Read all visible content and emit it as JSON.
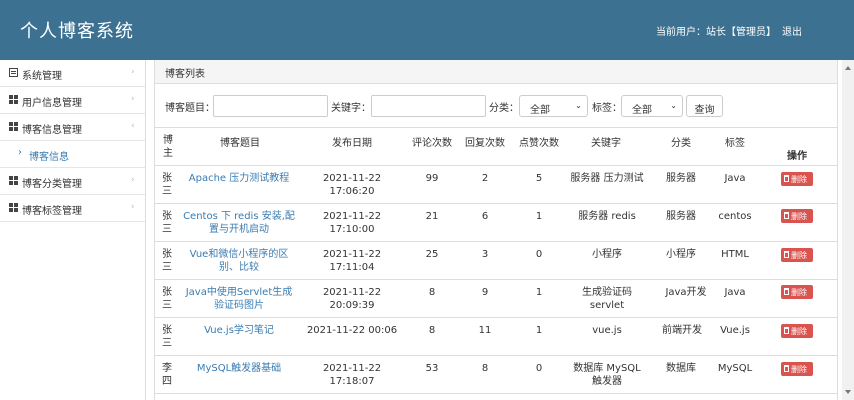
{
  "header": {
    "title": "个人博客系统",
    "user_info": "当前用户：站长【管理员】",
    "logout": "退出"
  },
  "sidebar": {
    "items": [
      {
        "label": "系统管理",
        "icon": "list-icon"
      },
      {
        "label": "用户信息管理",
        "icon": "grid-icon"
      },
      {
        "label": "博客信息管理",
        "icon": "grid-icon"
      },
      {
        "label": "博客分类管理",
        "icon": "grid-icon"
      },
      {
        "label": "博客标签管理",
        "icon": "grid-icon"
      }
    ],
    "sub_item": {
      "label": "博客信息",
      "icon": "chevron-right-icon"
    }
  },
  "panel": {
    "title": "博客列表"
  },
  "filters": {
    "title_label": "博客题目：",
    "title_value": "",
    "keyword_label": "关键字：",
    "keyword_value": "",
    "category_label": "分类：",
    "category_selected": "全部",
    "tag_label": "标签：",
    "tag_selected": "全部",
    "search_button": "查询"
  },
  "table": {
    "headers": {
      "author": "博主",
      "title": "博客题目",
      "date": "发布日期",
      "comments": "评论次数",
      "replies": "回复次数",
      "likes": "点赞次数",
      "keyword": "关键字",
      "category": "分类",
      "tag": "标签",
      "action": "操作"
    },
    "delete_label": "删除",
    "rows": [
      {
        "author": "张三",
        "title": "Apache 压力测试教程",
        "date": "2021-11-22 17:06:20",
        "comments": "99",
        "replies": "2",
        "likes": "5",
        "keyword": "服务器 压力测试",
        "category": "服务器",
        "tag": "Java"
      },
      {
        "author": "张三",
        "title": "Centos 下 redis 安装,配置与开机启动",
        "date": "2021-11-22 17:10:00",
        "comments": "21",
        "replies": "6",
        "likes": "1",
        "keyword": "服务器 redis",
        "category": "服务器",
        "tag": "centos"
      },
      {
        "author": "张三",
        "title": "Vue和微信小程序的区别、比较",
        "date": "2021-11-22 17:11:04",
        "comments": "25",
        "replies": "3",
        "likes": "0",
        "keyword": "小程序",
        "category": "小程序",
        "tag": "HTML"
      },
      {
        "author": "张三",
        "title": "Java中使用Servlet生成验证码图片",
        "date": "2021-11-22 20:09:39",
        "comments": "8",
        "replies": "9",
        "likes": "1",
        "keyword": "生成验证码 servlet",
        "category": "Java开发",
        "tag": "Java"
      },
      {
        "author": "张三",
        "title": "Vue.js学习笔记",
        "date": "2021-11-22 00:06",
        "comments": "8",
        "replies": "11",
        "likes": "1",
        "keyword": "vue.js",
        "category": "前端开发",
        "tag": "Vue.js"
      },
      {
        "author": "李四",
        "title": "MySQL触发器基础",
        "date": "2021-11-22 17:18:07",
        "comments": "53",
        "replies": "8",
        "likes": "0",
        "keyword": "数据库 MySQL 触发器",
        "category": "数据库",
        "tag": "MySQL"
      }
    ]
  }
}
